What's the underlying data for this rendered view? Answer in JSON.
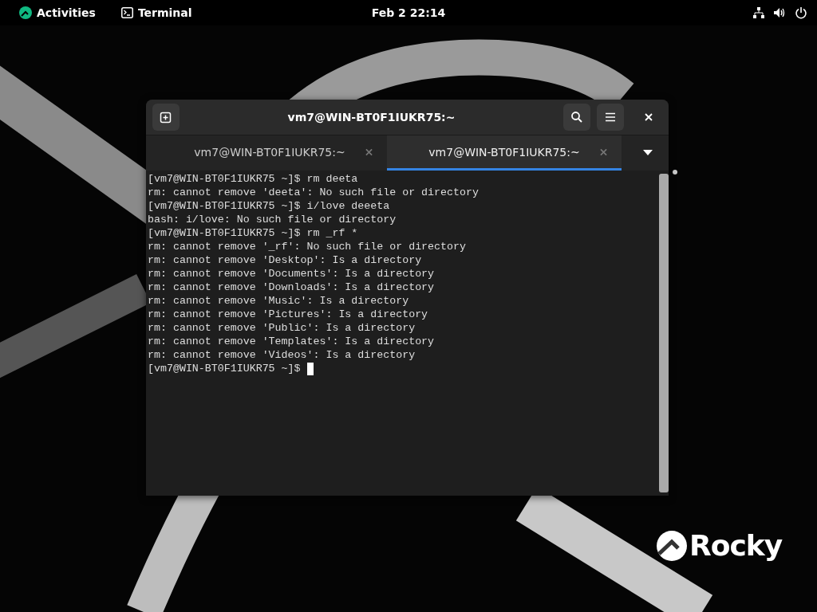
{
  "top_bar": {
    "activities": "Activities",
    "app": "Terminal",
    "clock": "Feb 2  22:14"
  },
  "wallpaper": {
    "logo_text": "Rocky"
  },
  "window": {
    "title": "vm7@WIN-BT0F1IUKR75:~",
    "tabs": [
      {
        "label": "vm7@WIN-BT0F1IUKR75:~",
        "selected": false
      },
      {
        "label": "vm7@WIN-BT0F1IUKR75:~",
        "selected": true
      }
    ],
    "terminal": {
      "lines": [
        {
          "text": "[vm7@WIN-BT0F1IUKR75 ~]$ rm deeta",
          "cursor": false
        },
        {
          "text": "rm: cannot remove 'deeta': No such file or directory",
          "cursor": false
        },
        {
          "text": "[vm7@WIN-BT0F1IUKR75 ~]$ i/love deeeta",
          "cursor": false
        },
        {
          "text": "bash: i/love: No such file or directory",
          "cursor": false
        },
        {
          "text": "[vm7@WIN-BT0F1IUKR75 ~]$ rm _rf *",
          "cursor": false
        },
        {
          "text": "rm: cannot remove '_rf': No such file or directory",
          "cursor": false
        },
        {
          "text": "rm: cannot remove 'Desktop': Is a directory",
          "cursor": false
        },
        {
          "text": "rm: cannot remove 'Documents': Is a directory",
          "cursor": false
        },
        {
          "text": "rm: cannot remove 'Downloads': Is a directory",
          "cursor": false
        },
        {
          "text": "rm: cannot remove 'Music': Is a directory",
          "cursor": false
        },
        {
          "text": "rm: cannot remove 'Pictures': Is a directory",
          "cursor": false
        },
        {
          "text": "rm: cannot remove 'Public': Is a directory",
          "cursor": false
        },
        {
          "text": "rm: cannot remove 'Templates': Is a directory",
          "cursor": false
        },
        {
          "text": "rm: cannot remove 'Videos': Is a directory",
          "cursor": false
        },
        {
          "text": "[vm7@WIN-BT0F1IUKR75 ~]$",
          "cursor": true
        }
      ]
    }
  }
}
